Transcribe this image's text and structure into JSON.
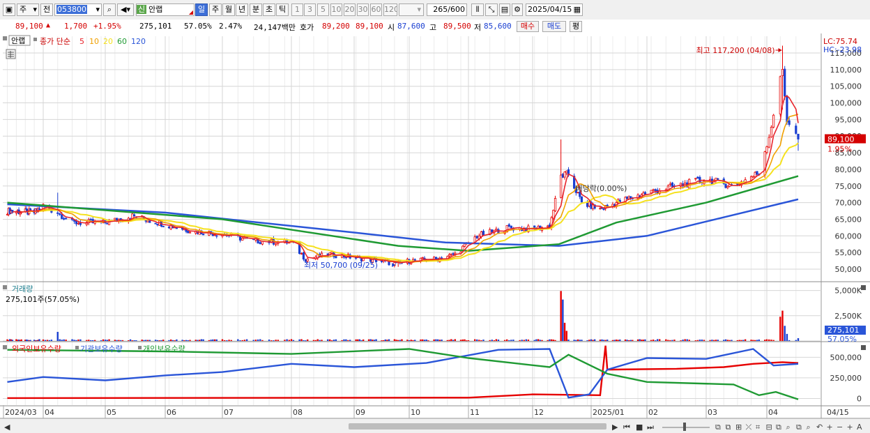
{
  "toolbar": {
    "market_label": "주",
    "prev_label": "전",
    "code": "053800",
    "company_badge": "신",
    "company_name": "안랩",
    "period_tabs": [
      "일",
      "주",
      "월",
      "년",
      "분",
      "초",
      "틱"
    ],
    "selected_period": "일",
    "interval_buttons": [
      "1",
      "3",
      "5",
      "10",
      "20",
      "30",
      "60",
      "120"
    ],
    "count_display": "265",
    "count_total": "/600",
    "date": "2025/04/15"
  },
  "quote": {
    "price": "89,100",
    "change": "1,700",
    "change_pct": "+1.95%",
    "volume": "275,101",
    "volume_ratio": "57.05%",
    "turnover_pct": "2.47%",
    "amount": "24,147백만",
    "bid_label": "호가",
    "ask_price": "89,200",
    "bid_price": "89,100",
    "open_label": "시",
    "open": "87,600",
    "high_label": "고",
    "high": "89,500",
    "low_label": "저",
    "low": "85,600",
    "buy_label": "매수",
    "sell_label": "매도",
    "avg_label": "평"
  },
  "price_panel": {
    "stock_label": "안랩",
    "legend_prefix": "종가 단순",
    "ma_labels": [
      "5",
      "10",
      "20",
      "60",
      "120"
    ],
    "lc_label": "LC:75.74",
    "hc_label": "HC:-23.98",
    "price_tag": "89,100",
    "pct_tag": "1.95%",
    "annotation_high": "최고 117,200 (04/08)",
    "annotation_low": "최저 50,700 (09/25)",
    "annotation_alloc": "배당락(0.00%)"
  },
  "volume_panel": {
    "title": "거래량",
    "readout": "275,101주(57.05%)",
    "value_tag": "275,101",
    "pct_tag": "57.05%"
  },
  "holding_panel": {
    "series_labels": [
      "외국인보유수량",
      "기관보유수량",
      "개인보유수량"
    ]
  },
  "colors": {
    "candle_up": "#e60000",
    "candle_down": "#1a3fd1",
    "ma5": "#e8232a",
    "ma10": "#f0a000",
    "ma20": "#f5e11e",
    "ma60": "#1f9a33",
    "ma120": "#2a55d8",
    "foreign": "#e60000",
    "institution": "#2a55d8",
    "individual": "#1f9a33",
    "grid": "#d6d6d6"
  },
  "chart_data": [
    {
      "type": "candlestick",
      "title": "안랩 종가 단순 5 10 20 60 120",
      "x_ticks": [
        "2024/03",
        "04",
        "05",
        "06",
        "07",
        "08",
        "09",
        "10",
        "11",
        "12",
        "2025/01",
        "02",
        "03",
        "04",
        "04/15"
      ],
      "y_ticks": [
        50000,
        55000,
        60000,
        65000,
        70000,
        75000,
        80000,
        85000,
        90000,
        95000,
        100000,
        105000,
        110000,
        115000
      ],
      "ylim": [
        47000,
        119000
      ],
      "closes": [
        {
          "date": "2024-03-04",
          "close": 67500
        },
        {
          "date": "2024-03-25",
          "close": 67000
        },
        {
          "date": "2024-04-01",
          "close": 69000
        },
        {
          "date": "2024-04-08",
          "close": 67000
        },
        {
          "date": "2024-04-15",
          "close": 64000
        },
        {
          "date": "2024-05-01",
          "close": 64000
        },
        {
          "date": "2024-05-15",
          "close": 66000
        },
        {
          "date": "2024-06-01",
          "close": 63500
        },
        {
          "date": "2024-06-15",
          "close": 61500
        },
        {
          "date": "2024-07-01",
          "close": 60500
        },
        {
          "date": "2024-07-15",
          "close": 58500
        },
        {
          "date": "2024-08-01",
          "close": 58000
        },
        {
          "date": "2024-08-08",
          "close": 53000
        },
        {
          "date": "2024-08-20",
          "close": 54500
        },
        {
          "date": "2024-09-01",
          "close": 53500
        },
        {
          "date": "2024-09-15",
          "close": 52500
        },
        {
          "date": "2024-09-25",
          "close": 51500
        },
        {
          "date": "2024-10-01",
          "close": 52500
        },
        {
          "date": "2024-10-15",
          "close": 53000
        },
        {
          "date": "2024-10-25",
          "close": 54500
        },
        {
          "date": "2024-11-05",
          "close": 60000
        },
        {
          "date": "2024-11-20",
          "close": 62500
        },
        {
          "date": "2024-12-01",
          "close": 62000
        },
        {
          "date": "2024-12-10",
          "close": 63000
        },
        {
          "date": "2024-12-16",
          "close": 78000
        },
        {
          "date": "2024-12-20",
          "close": 78500
        },
        {
          "date": "2024-12-27",
          "close": 70000
        },
        {
          "date": "2025-01-06",
          "close": 68000
        },
        {
          "date": "2025-01-15",
          "close": 70000
        },
        {
          "date": "2025-02-01",
          "close": 73000
        },
        {
          "date": "2025-02-15",
          "close": 75000
        },
        {
          "date": "2025-03-01",
          "close": 77000
        },
        {
          "date": "2025-03-15",
          "close": 75000
        },
        {
          "date": "2025-03-28",
          "close": 79000
        },
        {
          "date": "2025-04-02",
          "close": 90000
        },
        {
          "date": "2025-04-08",
          "close": 110000
        },
        {
          "date": "2025-04-10",
          "close": 95000
        },
        {
          "date": "2025-04-15",
          "close": 89100
        }
      ],
      "moving_averages": {
        "ma60": [
          {
            "date": "2024-03-04",
            "value": 70000
          },
          {
            "date": "2024-07-01",
            "value": 65000
          },
          {
            "date": "2024-09-25",
            "value": 57000
          },
          {
            "date": "2024-11-01",
            "value": 55500
          },
          {
            "date": "2024-12-15",
            "value": 57500
          },
          {
            "date": "2025-01-15",
            "value": 64000
          },
          {
            "date": "2025-03-01",
            "value": 70000
          },
          {
            "date": "2025-04-15",
            "value": 78000
          }
        ],
        "ma120": [
          {
            "date": "2024-03-04",
            "value": 69500
          },
          {
            "date": "2024-06-01",
            "value": 67000
          },
          {
            "date": "2024-09-01",
            "value": 61000
          },
          {
            "date": "2024-10-20",
            "value": 58000
          },
          {
            "date": "2024-12-15",
            "value": 57000
          },
          {
            "date": "2025-02-01",
            "value": 60000
          },
          {
            "date": "2025-04-15",
            "value": 71000
          }
        ]
      },
      "annotations": {
        "high": {
          "date": "2025-04-08",
          "value": 117200
        },
        "low": {
          "date": "2024-09-25",
          "value": 50700
        }
      }
    },
    {
      "type": "bar",
      "title": "거래량",
      "y_ticks": [
        0,
        2500000,
        5000000
      ],
      "y_tick_labels": [
        "2,500K",
        "5,000K"
      ],
      "ylim": [
        0,
        5800000
      ],
      "spikes": [
        {
          "date": "2024-04-08",
          "value": 900000
        },
        {
          "date": "2024-12-16",
          "value": 4950000
        },
        {
          "date": "2024-12-17",
          "value": 4100000
        },
        {
          "date": "2024-12-18",
          "value": 1800000
        },
        {
          "date": "2024-12-19",
          "value": 1000000
        },
        {
          "date": "2025-04-07",
          "value": 2400000
        },
        {
          "date": "2025-04-08",
          "value": 3000000
        },
        {
          "date": "2025-04-09",
          "value": 1500000
        },
        {
          "date": "2025-04-10",
          "value": 700000
        },
        {
          "date": "2025-04-15",
          "value": 275101
        }
      ],
      "baseline_volume": 120000
    },
    {
      "type": "line",
      "title": "보유수량",
      "y_ticks": [
        0,
        250000,
        500000
      ],
      "y_tick_labels": [
        "0",
        "250,000",
        "500,000"
      ],
      "ylim": [
        -80000,
        680000
      ],
      "series": [
        {
          "name": "외국인보유수량",
          "points": [
            {
              "date": "2024-03-04",
              "value": 5000
            },
            {
              "date": "2024-11-01",
              "value": 10000
            },
            {
              "date": "2024-12-01",
              "value": 50000
            },
            {
              "date": "2025-01-06",
              "value": 40000
            },
            {
              "date": "2025-01-09",
              "value": 640000
            },
            {
              "date": "2025-01-10",
              "value": 350000
            },
            {
              "date": "2025-02-15",
              "value": 360000
            },
            {
              "date": "2025-03-10",
              "value": 380000
            },
            {
              "date": "2025-03-25",
              "value": 420000
            },
            {
              "date": "2025-04-08",
              "value": 440000
            },
            {
              "date": "2025-04-15",
              "value": 430000
            }
          ]
        },
        {
          "name": "기관보유수량",
          "points": [
            {
              "date": "2024-03-04",
              "value": 200000
            },
            {
              "date": "2024-04-01",
              "value": 260000
            },
            {
              "date": "2024-05-01",
              "value": 220000
            },
            {
              "date": "2024-06-01",
              "value": 280000
            },
            {
              "date": "2024-07-01",
              "value": 320000
            },
            {
              "date": "2024-08-01",
              "value": 420000
            },
            {
              "date": "2024-09-01",
              "value": 380000
            },
            {
              "date": "2024-10-10",
              "value": 430000
            },
            {
              "date": "2024-11-15",
              "value": 590000
            },
            {
              "date": "2024-12-10",
              "value": 600000
            },
            {
              "date": "2024-12-20",
              "value": 10000
            },
            {
              "date": "2024-12-31",
              "value": 50000
            },
            {
              "date": "2025-01-10",
              "value": 350000
            },
            {
              "date": "2025-02-01",
              "value": 490000
            },
            {
              "date": "2025-03-01",
              "value": 480000
            },
            {
              "date": "2025-03-25",
              "value": 600000
            },
            {
              "date": "2025-04-04",
              "value": 400000
            },
            {
              "date": "2025-04-15",
              "value": 420000
            }
          ]
        },
        {
          "name": "개인보유수량",
          "points": [
            {
              "date": "2024-03-04",
              "value": 590000
            },
            {
              "date": "2024-06-01",
              "value": 570000
            },
            {
              "date": "2024-08-01",
              "value": 540000
            },
            {
              "date": "2024-10-01",
              "value": 600000
            },
            {
              "date": "2024-11-01",
              "value": 490000
            },
            {
              "date": "2024-12-10",
              "value": 380000
            },
            {
              "date": "2024-12-20",
              "value": 530000
            },
            {
              "date": "2025-01-10",
              "value": 300000
            },
            {
              "date": "2025-02-01",
              "value": 200000
            },
            {
              "date": "2025-03-15",
              "value": 170000
            },
            {
              "date": "2025-03-28",
              "value": 40000
            },
            {
              "date": "2025-04-05",
              "value": 80000
            },
            {
              "date": "2025-04-15",
              "value": -10000
            }
          ]
        }
      ]
    }
  ]
}
